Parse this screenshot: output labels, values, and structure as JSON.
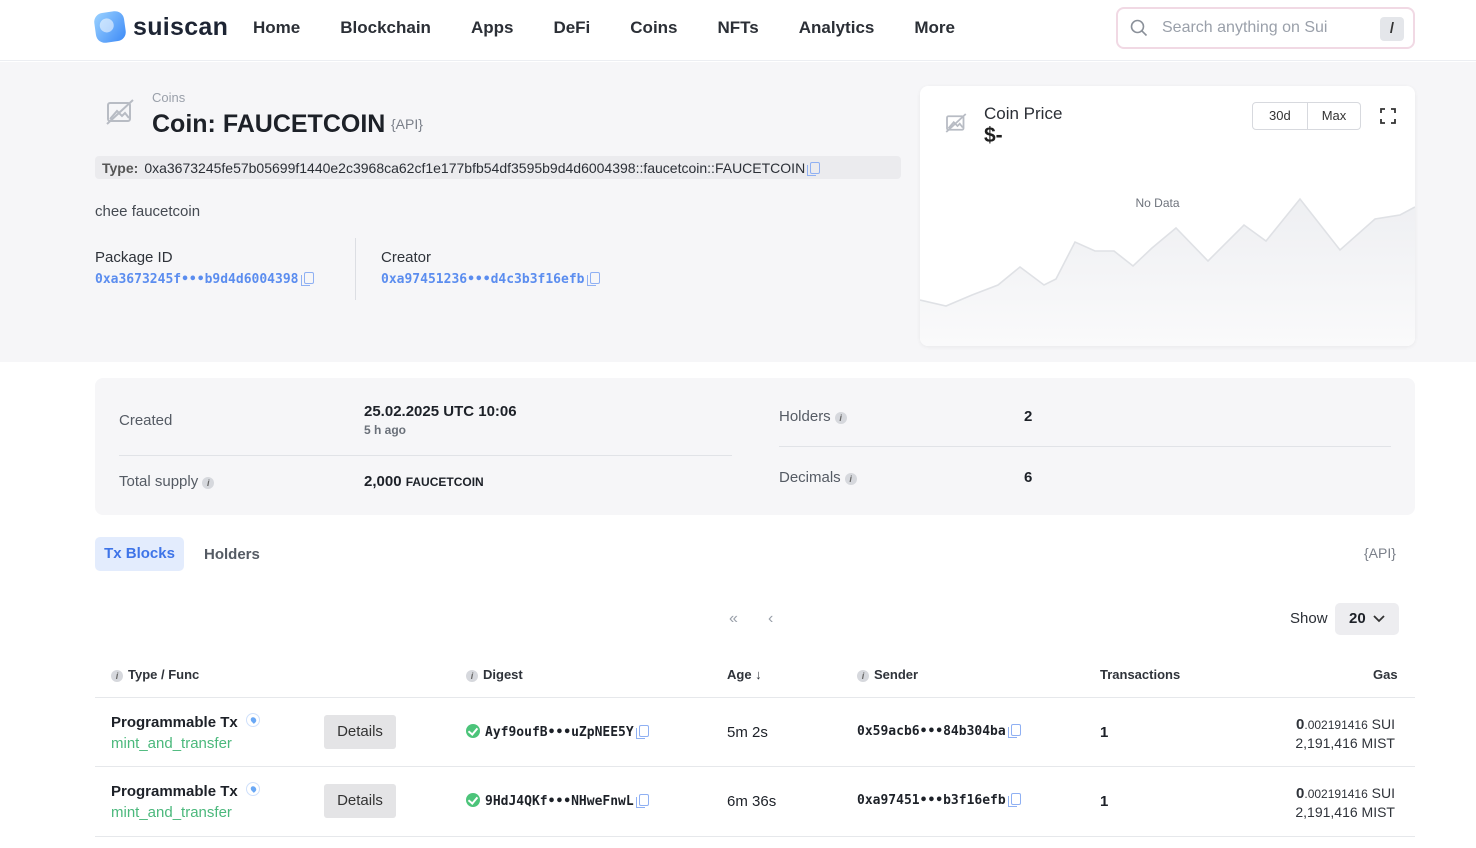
{
  "header": {
    "logo_text": "suiscan",
    "nav": [
      "Home",
      "Blockchain",
      "Apps",
      "DeFi",
      "Coins",
      "NFTs",
      "Analytics",
      "More"
    ],
    "search_placeholder": "Search anything on Sui",
    "search_shortcut": "/"
  },
  "coin": {
    "breadcrumb": "Coins",
    "title": "Coin: FAUCETCOIN",
    "api_label": "{API}",
    "type_label": "Type:",
    "type_value": "0xa3673245fe57b05699f1440e2c3968ca62cf1e177bfb54df3595b9d4d6004398::faucetcoin::FAUCETCOIN",
    "description": "chee faucetcoin",
    "package_label": "Package ID",
    "package_value": "0xa3673245f•••b9d4d6004398",
    "creator_label": "Creator",
    "creator_value": "0xa97451236•••d4c3b3f16efb"
  },
  "price": {
    "title": "Coin Price",
    "value": "$-",
    "ranges": [
      "30d",
      "Max"
    ],
    "no_data": "No Data"
  },
  "stats": {
    "created_label": "Created",
    "created_value": "25.02.2025 UTC 10:06",
    "created_ago": "5 h ago",
    "supply_label": "Total supply",
    "supply_value": "2,000",
    "supply_unit": "FAUCETCOIN",
    "holders_label": "Holders",
    "holders_value": "2",
    "decimals_label": "Decimals",
    "decimals_value": "6"
  },
  "tabs": {
    "active": "Tx Blocks",
    "other": "Holders",
    "api_label": "{API}",
    "first_page": "«",
    "prev_page": "‹",
    "show_label": "Show",
    "show_value": "20"
  },
  "table": {
    "headers": {
      "type": "Type / Func",
      "digest": "Digest",
      "age": "Age ↓",
      "sender": "Sender",
      "transactions": "Transactions",
      "gas": "Gas"
    },
    "details_label": "Details",
    "rows": [
      {
        "type": "Programmable Tx",
        "func": "mint_and_transfer",
        "digest": "Ayf9oufB•••uZpNEE5Y",
        "age": "5m 2s",
        "sender": "0x59acb6•••84b304ba",
        "transactions": "1",
        "gas_int": "0",
        "gas_frac": ".002191416",
        "gas_unit": "SUI",
        "gas_mist": "2,191,416 MIST"
      },
      {
        "type": "Programmable Tx",
        "func": "mint_and_transfer",
        "digest": "9HdJ4QKf•••NHweFnwL",
        "age": "6m 36s",
        "sender": "0xa97451•••b3f16efb",
        "transactions": "1",
        "gas_int": "0",
        "gas_frac": ".002191416",
        "gas_unit": "SUI",
        "gas_mist": "2,191,416 MIST"
      }
    ]
  },
  "colors": {
    "accent": "#5b8def",
    "success": "#4cc47a",
    "func": "#4bb87c"
  }
}
